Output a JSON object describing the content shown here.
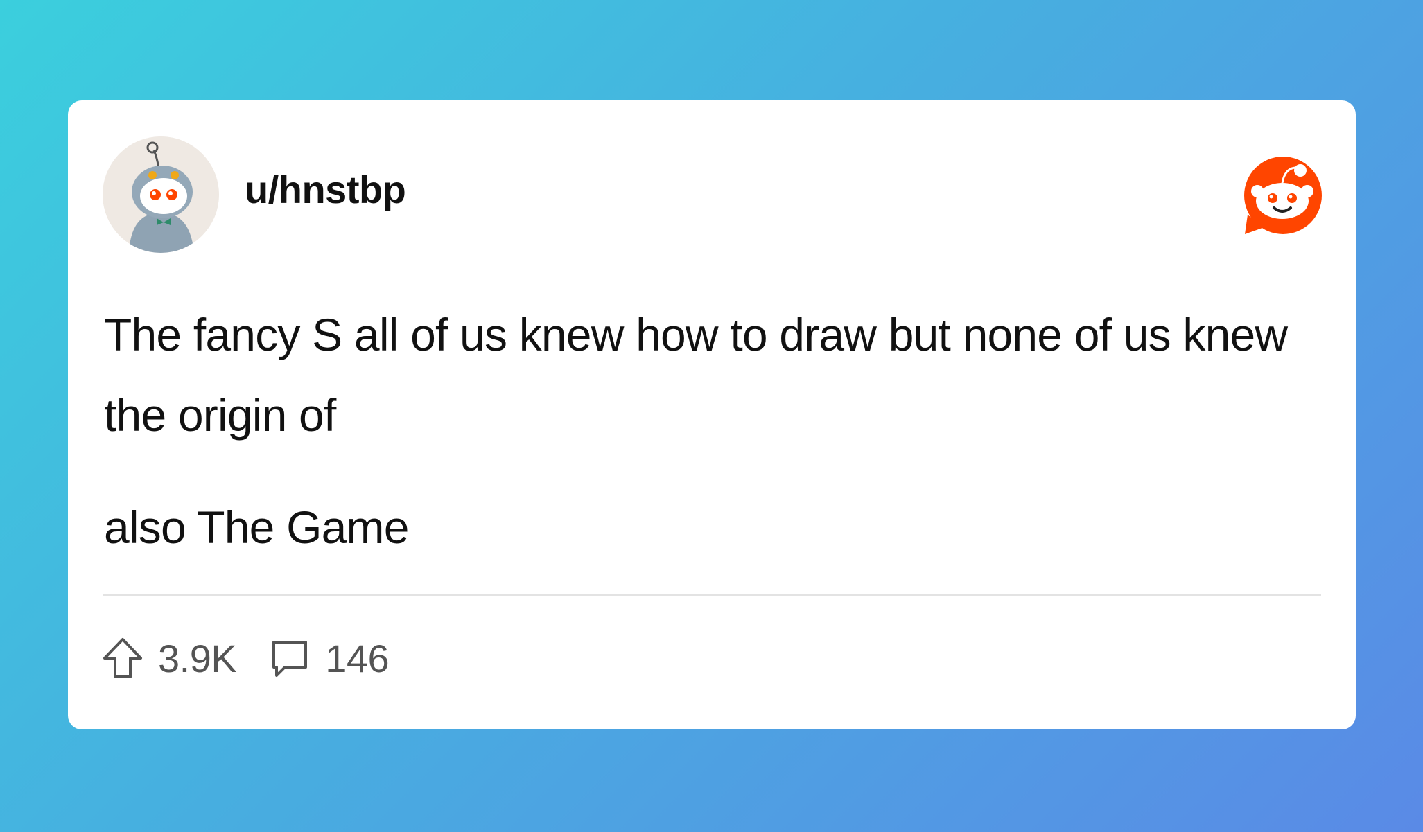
{
  "post": {
    "username": "u/hnstbp",
    "body_line_1": "The fancy S all of us knew how to draw but none of us knew the origin of",
    "body_line_2": "also The Game"
  },
  "stats": {
    "upvotes": "3.9K",
    "comments": "146"
  },
  "colors": {
    "background_start": "#3bcfdd",
    "background_end": "#5a8ae6",
    "card": "#ffffff",
    "brand_orange": "#ff4500",
    "text": "#111111",
    "muted_text": "#545454"
  },
  "icons": {
    "avatar": "snoo-avatar-icon",
    "brand": "reddit-logo-icon",
    "upvote": "upvote-arrow-icon",
    "comment": "comment-bubble-icon"
  }
}
